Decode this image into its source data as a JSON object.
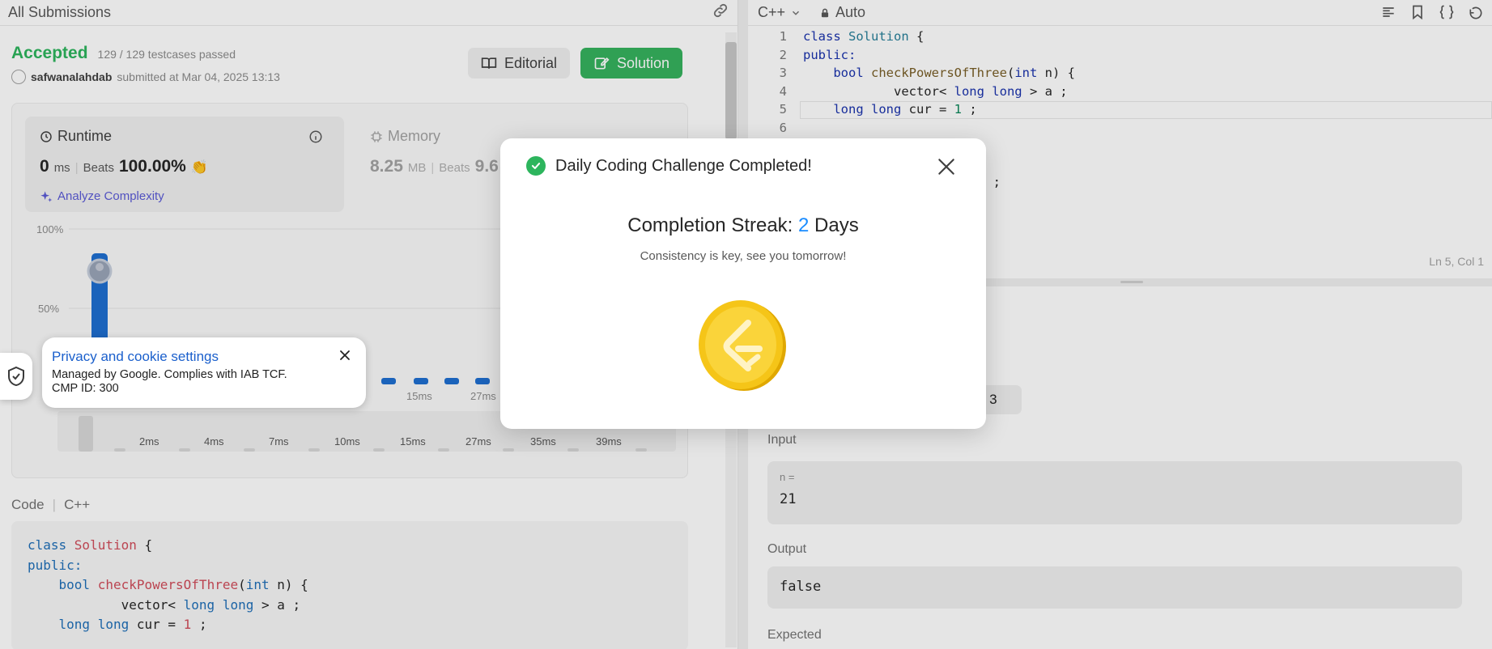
{
  "left": {
    "header_title": "All Submissions",
    "status": "Accepted",
    "testcases": "129 / 129 testcases passed",
    "username": "safwanalahdab",
    "submitted_text": "submitted at Mar 04, 2025 13:13",
    "editorial_label": "Editorial",
    "solution_label": "Solution",
    "runtime": {
      "title": "Runtime",
      "value": "0",
      "unit": "ms",
      "beats_label": "Beats",
      "beats_value": "100.00%",
      "analyze_label": "Analyze Complexity"
    },
    "memory": {
      "title": "Memory",
      "value": "8.25",
      "unit": "MB",
      "beats_label": "Beats",
      "beats_value": "9.6"
    },
    "chart_y_labels": [
      "100%",
      "50%"
    ],
    "chart_x_labels_top": [
      "15ms",
      "27ms"
    ],
    "chart_x_labels_bottom": [
      "2ms",
      "4ms",
      "7ms",
      "10ms",
      "15ms",
      "27ms",
      "35ms",
      "39ms"
    ],
    "code_label": "Code",
    "code_lang": "C++",
    "code_lines": [
      [
        "class ",
        "Solution",
        " {"
      ],
      [
        "public:"
      ],
      [
        "    bool ",
        "checkPowersOfThree",
        "(",
        "int",
        " n) {"
      ],
      [
        "            vector< ",
        "long long",
        " > a ;"
      ],
      [
        "    ",
        "long long",
        " cur = ",
        "1",
        " ;"
      ]
    ]
  },
  "editor": {
    "language": "C++",
    "mode": "Auto",
    "cursor_pos": "Ln 5, Col 1",
    "line_numbers": [
      "1",
      "2",
      "3",
      "4",
      "5",
      "6"
    ],
    "partial_line_text": ") ;"
  },
  "testcase": {
    "case_label": "ase 3",
    "input_label": "Input",
    "input_var": "n =",
    "input_value": "21",
    "output_label": "Output",
    "output_value": "false",
    "expected_label": "Expected"
  },
  "modal": {
    "title": "Daily Coding Challenge Completed!",
    "streak_prefix": "Completion Streak:",
    "streak_count": "2",
    "streak_suffix": "Days",
    "tagline": "Consistency is key, see you tomorrow!"
  },
  "privacy": {
    "title": "Privacy and cookie settings",
    "line1": "Managed by Google. Complies with IAB TCF.",
    "line2": "CMP ID: 300"
  },
  "colors": {
    "accepted": "#2db55d",
    "solution_btn": "#36b35e",
    "streak_number": "#1a8cff",
    "coin_gold": "#f5c518"
  }
}
